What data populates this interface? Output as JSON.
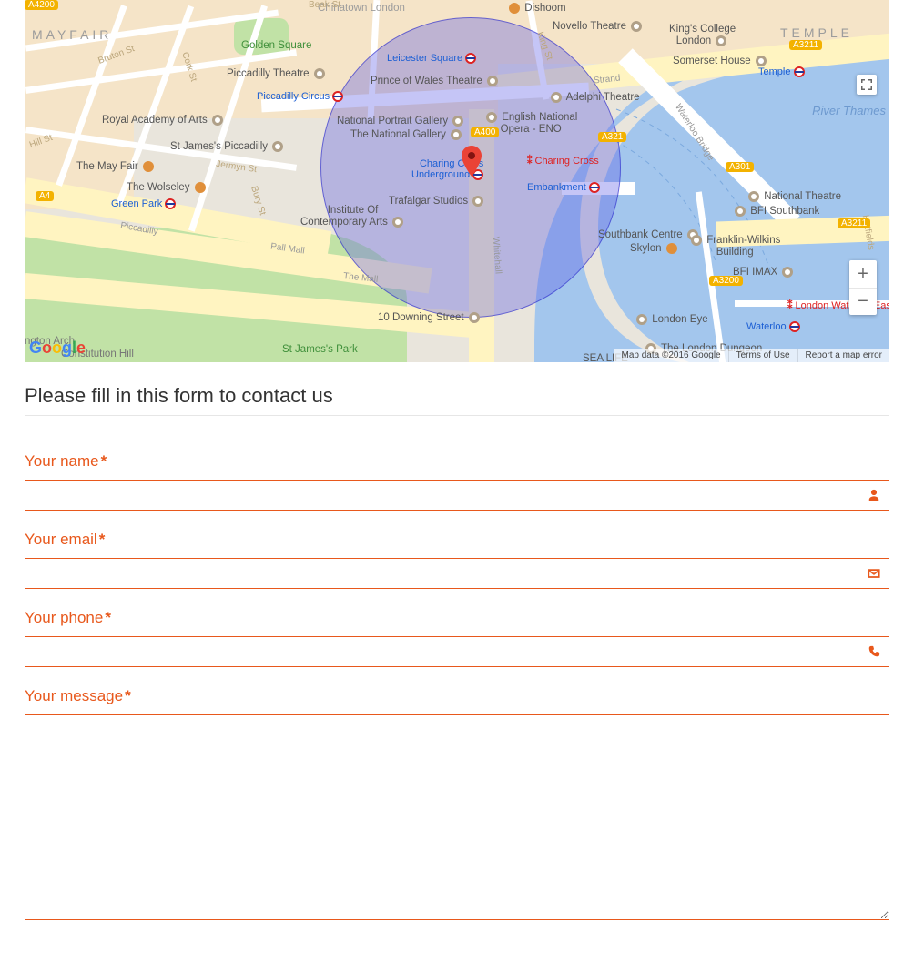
{
  "map": {
    "districts": {
      "mayfair": "MAYFAIR",
      "temple": "TEMPLE",
      "chinatown": "Chinatown London"
    },
    "pois": {
      "golden_square": "Golden Square",
      "piccadilly_theatre": "Piccadilly Theatre",
      "royal_academy": "Royal Academy of Arts",
      "st_james_piccadilly": "St James's Piccadilly",
      "the_may_fair": "The May Fair",
      "the_wolseley": "The Wolseley",
      "dishoom": "Dishoom",
      "novello_theatre": "Novello Theatre",
      "kings_college": "King's College\nLondon",
      "somerset_house": "Somerset House",
      "prince_of_wales": "Prince of Wales Theatre",
      "leicester_square_lbl": "Leicester Square",
      "adelphi_theatre": "Adelphi Theatre",
      "national_portrait": "National Portrait Gallery",
      "national_gallery": "The National Gallery",
      "english_national_opera": "English National\nOpera - ENO",
      "trafalgar_studios": "Trafalgar Studios",
      "institute_contemporary": "Institute Of\nContemporary Arts",
      "ten_downing": "10 Downing Street",
      "st_james_park": "St James's Park",
      "national_theatre": "National Theatre",
      "bfi_southbank": "BFI Southbank",
      "southbank_centre": "Southbank Centre",
      "skylon": "Skylon",
      "franklin_wilkins": "Franklin-Wilkins\nBuilding",
      "bfi_imax": "BFI IMAX",
      "london_eye": "London Eye",
      "london_dungeon": "The London Dungeon",
      "sea_life": "SEA LIFE",
      "river_thames": "River Thames",
      "constitution_hill": "Constitution Hill",
      "ngton_arch": "ngton Arch"
    },
    "stations": {
      "piccadilly_circus": "Piccadilly Circus",
      "green_park": "Green Park",
      "leicester_square": "Leicester Square",
      "embankment": "Embankment",
      "charing_cross_ug": "Charing Cross\nUnderground",
      "charing_cross_rail": "Charing Cross",
      "temple": "Temple",
      "waterloo": "Waterloo",
      "london_waterloo_east": "London Waterloo East"
    },
    "roads": {
      "bruton_st": "Bruton St",
      "hill_st": "Hill St",
      "jermyn_st": "Jermyn St",
      "piccadilly": "Piccadilly",
      "pall_mall": "Pall Mall",
      "the_mall": "The Mall",
      "strand": "Strand",
      "whitehall": "Whitehall",
      "beak_st": "Beak St",
      "cork_st": "Cork St",
      "king_st": "King St",
      "bury_st": "Bury St",
      "waterloo_bridge": "Waterloo Bridge",
      "hatfields": "Hatfields",
      "a400": "A400",
      "a4": "A4",
      "a3211_left": "A3211",
      "a3211_right": "A3211",
      "a3200": "A3200",
      "a4200": "A4200",
      "a301": "A301",
      "a321": "A321"
    },
    "controls": {
      "zoom_in": "+",
      "zoom_out": "−"
    },
    "credits": {
      "data": "Map data ©2016 Google",
      "terms": "Terms of Use",
      "report": "Report a map error"
    }
  },
  "form": {
    "title": "Please fill in this form to contact us",
    "fields": {
      "name": {
        "label": "Your name",
        "required": "*"
      },
      "email": {
        "label": "Your email",
        "required": "*"
      },
      "phone": {
        "label": "Your phone",
        "required": "*"
      },
      "message": {
        "label": "Your message",
        "required": "*"
      }
    }
  }
}
